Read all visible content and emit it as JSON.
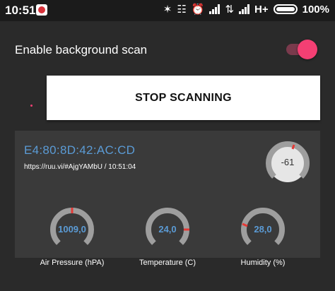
{
  "status_bar": {
    "time": "10:51",
    "network_type": "H+",
    "battery": "100%"
  },
  "settings": {
    "background_scan_label": "Enable background scan",
    "background_scan_enabled": true
  },
  "actions": {
    "stop_scanning_label": "STOP SCANNING"
  },
  "tag": {
    "mac": "E4:80:8D:42:AC:CD",
    "url_time": "https://ruu.vi/#AjgYAMbU  /  10:51:04",
    "rssi": "-61",
    "pressure": {
      "value": "1009,0",
      "label": "Air Pressure (hPA)"
    },
    "temperature": {
      "value": "24,0",
      "label": "Temperature (C)"
    },
    "humidity": {
      "value": "28,0",
      "label": "Humidity (%)"
    }
  },
  "colors": {
    "accent": "#f43f73",
    "value_blue": "#5b9bd5",
    "gauge_ring": "#9e9e9e",
    "gauge_marker": "#e53935"
  }
}
